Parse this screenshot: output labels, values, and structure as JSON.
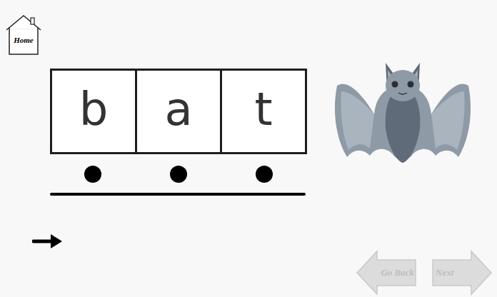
{
  "home": {
    "label": "Home"
  },
  "word": {
    "letters": [
      {
        "text": "b"
      },
      {
        "text": "a"
      },
      {
        "text": "t"
      }
    ]
  },
  "navigation": [
    {
      "label": "Go Back",
      "kind": "back",
      "disabled": true
    },
    {
      "label": "Next",
      "kind": "next",
      "disabled": true
    }
  ]
}
